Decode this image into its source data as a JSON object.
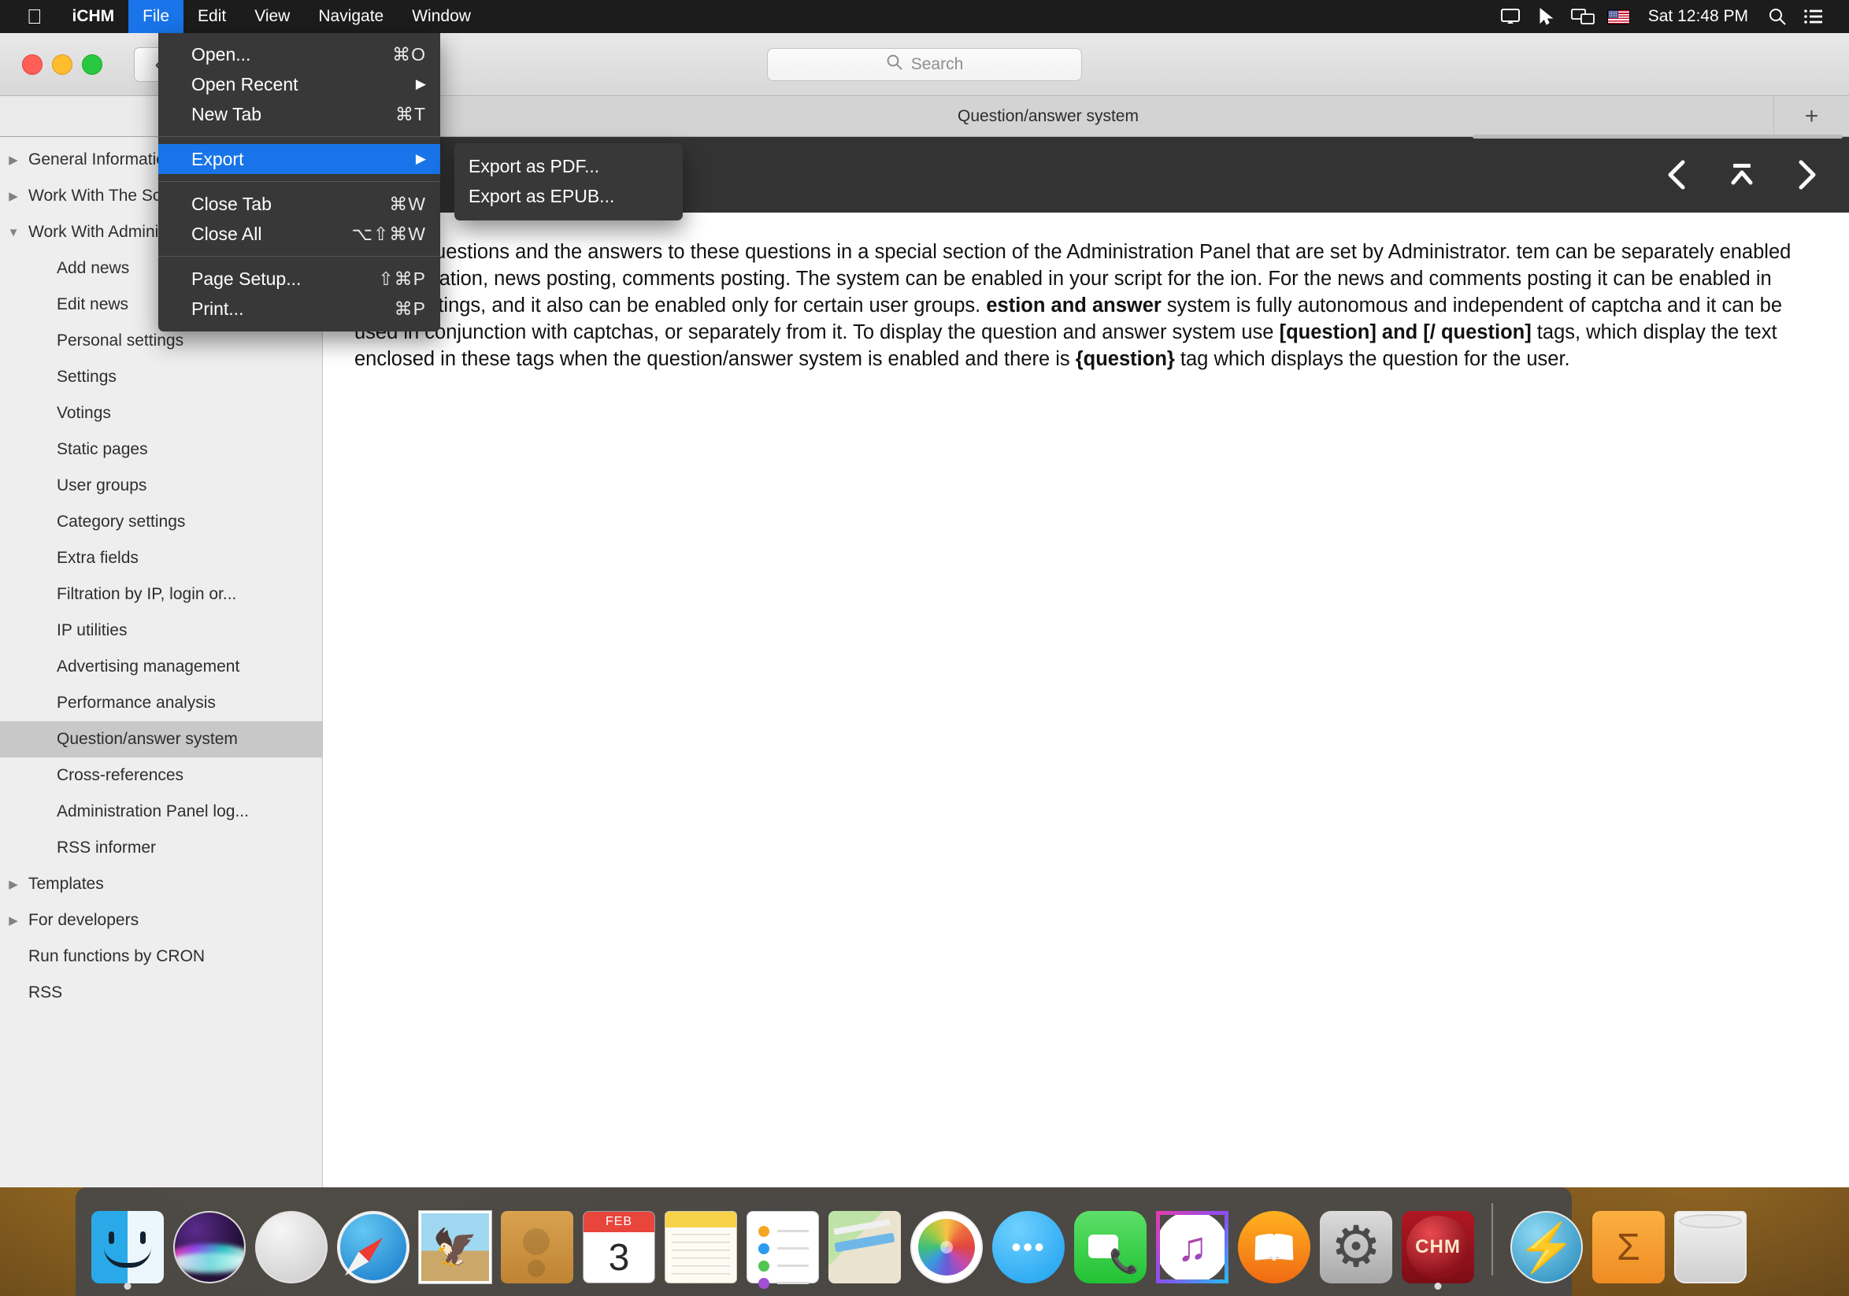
{
  "menubar": {
    "apple_icon": "apple-logo-icon",
    "app_name": "iCHM",
    "items": [
      {
        "label": "File",
        "active": true
      },
      {
        "label": "Edit",
        "active": false
      },
      {
        "label": "View",
        "active": false
      },
      {
        "label": "Navigate",
        "active": false
      },
      {
        "label": "Window",
        "active": false
      }
    ],
    "status_icons": [
      "airplay-display-icon",
      "cursor-pointer-icon",
      "screen-mirroring-icon",
      "us-flag-icon"
    ],
    "clock": "Sat 12:48 PM",
    "search_icon": "spotlight-search-icon",
    "control_center_icon": "notification-center-icon"
  },
  "file_menu": {
    "items": [
      {
        "label": "Open...",
        "shortcut": "⌘O",
        "submenu": false,
        "highlight": false
      },
      {
        "label": "Open Recent",
        "shortcut": "",
        "submenu": true,
        "highlight": false
      },
      {
        "label": "New Tab",
        "shortcut": "⌘T",
        "submenu": false,
        "highlight": false
      },
      {
        "separator": true
      },
      {
        "label": "Export",
        "shortcut": "",
        "submenu": true,
        "highlight": true
      },
      {
        "separator": true
      },
      {
        "label": "Close Tab",
        "shortcut": "⌘W",
        "submenu": false,
        "highlight": false
      },
      {
        "label": "Close All",
        "shortcut": "⌥⇧⌘W",
        "submenu": false,
        "highlight": false
      },
      {
        "separator": true
      },
      {
        "label": "Page Setup...",
        "shortcut": "⇧⌘P",
        "submenu": false,
        "highlight": false
      },
      {
        "label": "Print...",
        "shortcut": "⌘P",
        "submenu": false,
        "highlight": false
      }
    ]
  },
  "export_submenu": {
    "items": [
      {
        "label": "Export as PDF..."
      },
      {
        "label": "Export as EPUB..."
      }
    ]
  },
  "titlebar": {
    "back_icon": "chevron-left-icon",
    "close_label": "",
    "minimize_label": "",
    "zoom_label": ""
  },
  "search": {
    "placeholder": "Search",
    "icon": "search-icon"
  },
  "tabbar": {
    "book_icon": "book-toc-icon",
    "list_icon": "list-lines-icon",
    "title": "Question/answer system",
    "add_tab_icon": "plus-icon"
  },
  "docnav": {
    "prev_icon": "chevron-left-icon",
    "top_icon": "jump-to-top-icon",
    "next_icon": "chevron-right-icon"
  },
  "sidebar": {
    "items": [
      {
        "label": "General Information",
        "level": 0,
        "twisty": "collapsed",
        "selected": false
      },
      {
        "label": "Work With The Script",
        "level": 0,
        "twisty": "collapsed",
        "selected": false
      },
      {
        "label": "Work With Administration Panel",
        "level": 0,
        "twisty": "expanded",
        "selected": false
      },
      {
        "label": "Add news",
        "level": 1,
        "twisty": "none",
        "selected": false
      },
      {
        "label": "Edit news",
        "level": 1,
        "twisty": "none",
        "selected": false
      },
      {
        "label": "Personal settings",
        "level": 1,
        "twisty": "none",
        "selected": false
      },
      {
        "label": "Settings",
        "level": 1,
        "twisty": "none",
        "selected": false
      },
      {
        "label": "Votings",
        "level": 1,
        "twisty": "none",
        "selected": false
      },
      {
        "label": "Static pages",
        "level": 1,
        "twisty": "none",
        "selected": false
      },
      {
        "label": "User groups",
        "level": 1,
        "twisty": "none",
        "selected": false
      },
      {
        "label": "Category settings",
        "level": 1,
        "twisty": "none",
        "selected": false
      },
      {
        "label": "Extra fields",
        "level": 1,
        "twisty": "none",
        "selected": false
      },
      {
        "label": "Filtration by IP, login or...",
        "level": 1,
        "twisty": "none",
        "selected": false
      },
      {
        "label": "IP utilities",
        "level": 1,
        "twisty": "none",
        "selected": false
      },
      {
        "label": "Advertising management",
        "level": 1,
        "twisty": "none",
        "selected": false
      },
      {
        "label": "Performance analysis",
        "level": 1,
        "twisty": "none",
        "selected": false
      },
      {
        "label": "Question/answer system",
        "level": 1,
        "twisty": "none",
        "selected": true
      },
      {
        "label": "Cross-references",
        "level": 1,
        "twisty": "none",
        "selected": false
      },
      {
        "label": "Administration Panel log...",
        "level": 1,
        "twisty": "none",
        "selected": false
      },
      {
        "label": "RSS informer",
        "level": 1,
        "twisty": "none",
        "selected": false
      },
      {
        "label": "Templates",
        "level": 0,
        "twisty": "collapsed",
        "selected": false
      },
      {
        "label": "For developers",
        "level": 0,
        "twisty": "collapsed",
        "selected": false
      },
      {
        "label": "Run functions by CRON",
        "level": 0,
        "twisty": "none",
        "selected": false
      },
      {
        "label": "RSS",
        "level": 0,
        "twisty": "none",
        "selected": false
      }
    ]
  },
  "document": {
    "paragraph_segments": [
      {
        "text": "a list of questions and the answers to these questions in a special section of the Administration Panel that are set by Administrator. ",
        "bold": false
      },
      {
        "text": "tem can be separately enabled for registration, news posting, comments posting. The system can be enabled in your script for the ",
        "bold": false
      },
      {
        "text": "ion. For the news and comments posting it can be enabled in group settings, and it also can be enabled only for certain user groups. ",
        "bold": false
      },
      {
        "text": "estion and answer",
        "bold": true
      },
      {
        "text": " system is fully autonomous and independent of captcha and it can be used in conjunction with captchas, or separately from it. To display the question and answer system use ",
        "bold": false
      },
      {
        "text": "[question] and [/ question]",
        "bold": true
      },
      {
        "text": " tags, which display the text enclosed in these tags when the question/answer system is enabled and there is ",
        "bold": false
      },
      {
        "text": "{question}",
        "bold": true
      },
      {
        "text": " tag which displays the question for the user.",
        "bold": false
      }
    ]
  },
  "dock": {
    "items": [
      {
        "name": "finder",
        "icon_class": "ic-finder",
        "running": true
      },
      {
        "name": "siri",
        "icon_class": "ic-siri",
        "running": false
      },
      {
        "name": "launchpad",
        "icon_class": "ic-launch",
        "running": false
      },
      {
        "name": "safari",
        "icon_class": "ic-safari",
        "running": false
      },
      {
        "name": "mail",
        "icon_class": "ic-mail",
        "running": false
      },
      {
        "name": "contacts",
        "icon_class": "ic-contacts",
        "running": false
      },
      {
        "name": "calendar",
        "icon_class": "ic-cal",
        "running": false,
        "month": "FEB",
        "day": "3"
      },
      {
        "name": "notes",
        "icon_class": "ic-notes",
        "running": false
      },
      {
        "name": "reminders",
        "icon_class": "ic-reminders",
        "running": false
      },
      {
        "name": "maps",
        "icon_class": "ic-maps",
        "running": false
      },
      {
        "name": "photos",
        "icon_class": "ic-photos",
        "running": false
      },
      {
        "name": "messages",
        "icon_class": "ic-messages",
        "running": false
      },
      {
        "name": "facetime",
        "icon_class": "ic-facetime",
        "running": false
      },
      {
        "name": "itunes",
        "icon_class": "ic-itunes",
        "running": false
      },
      {
        "name": "ibooks",
        "icon_class": "ic-ibooks",
        "running": false
      },
      {
        "name": "system-preferences",
        "icon_class": "ic-sysprefs",
        "running": false
      },
      {
        "name": "ichm",
        "icon_class": "ic-chm",
        "running": true,
        "badge": "CHM"
      },
      {
        "divider": true
      },
      {
        "name": "downloads-bolt",
        "icon_class": "ic-bolt",
        "running": false
      },
      {
        "name": "documents-folder",
        "icon_class": "ic-sigma",
        "running": false,
        "badge": "Σ"
      },
      {
        "name": "trash",
        "icon_class": "ic-trash",
        "running": false
      }
    ]
  },
  "colors": {
    "menu_highlight": "#1874e8",
    "menu_bg": "#383838",
    "sidebar_bg": "#eeeeee",
    "selection_bg": "#c8c8c8",
    "docnav_bg": "#333333"
  }
}
